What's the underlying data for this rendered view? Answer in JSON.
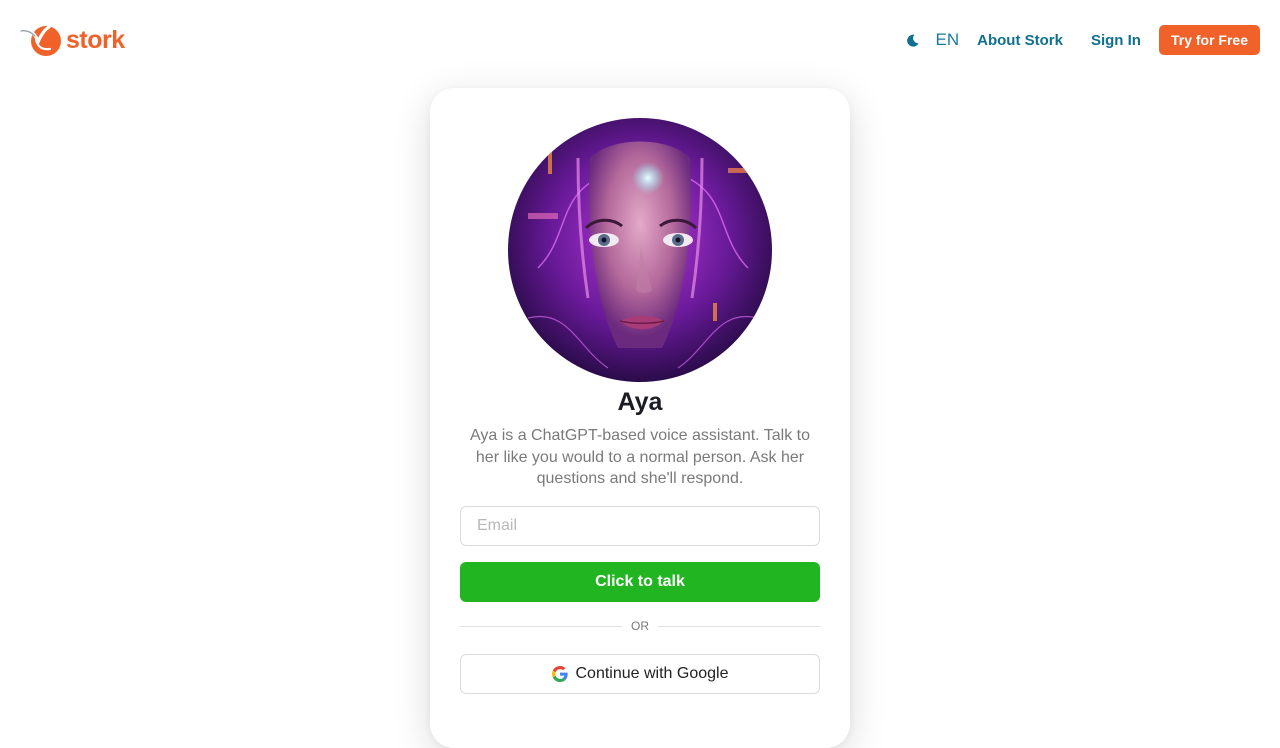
{
  "header": {
    "logo_text": "stork",
    "logo_icon": "stork-bird-icon",
    "theme_icon": "moon-icon",
    "language": "EN",
    "nav": {
      "about": "About Stork",
      "signin": "Sign In",
      "try_free": "Try for Free"
    }
  },
  "card": {
    "avatar_icon": "ai-woman-portrait",
    "name": "Aya",
    "description": "Aya is a ChatGPT-based voice assistant. Talk to her like you would to a normal person. Ask her questions and she'll respond.",
    "email_placeholder": "Email",
    "email_value": "",
    "talk_button": "Click to talk",
    "divider_text": "OR",
    "google_button": "Continue with Google",
    "google_icon": "google-g-icon"
  },
  "colors": {
    "brand_orange": "#f0622a",
    "nav_teal": "#10708f",
    "talk_green": "#21b521",
    "text_dark": "#1c1c24",
    "text_muted": "#7a7a7a"
  }
}
